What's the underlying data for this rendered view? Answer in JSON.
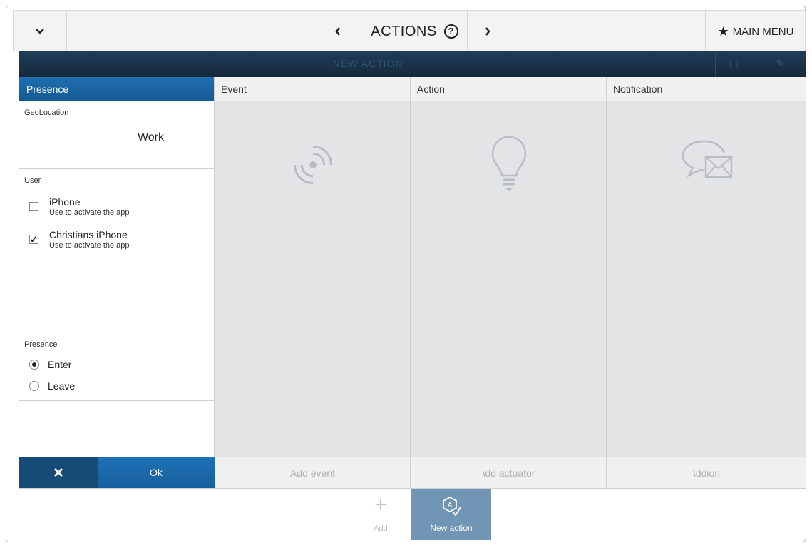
{
  "topbar": {
    "menu_toggle_icon": "chevron-down-icon",
    "prev_icon": "chevron-left-icon",
    "title": "ACTIONS",
    "help_label": "?",
    "next_icon": "chevron-right-icon",
    "main_menu_label": "MAIN MENU",
    "main_menu_icon": "star-icon"
  },
  "darkbar": {
    "title": "NEW ACTION",
    "icons": [
      "trash-icon",
      "wrench-icon"
    ]
  },
  "left_panel": {
    "header": "Presence",
    "geolocation": {
      "label": "GeoLocation",
      "value": "Work"
    },
    "user": {
      "label": "User",
      "items": [
        {
          "name": "iPhone",
          "sub": "Use to activate the app",
          "checked": false
        },
        {
          "name": "Christians iPhone",
          "sub": "Use to activate the app",
          "checked": true
        }
      ]
    },
    "presence": {
      "label": "Presence",
      "options": [
        {
          "label": "Enter",
          "selected": true
        },
        {
          "label": "Leave",
          "selected": false
        }
      ]
    },
    "cancel_icon": "close-icon",
    "ok_label": "Ok"
  },
  "columns": [
    {
      "header": "Event",
      "icon": "signal-icon",
      "footer": "Add event"
    },
    {
      "header": "Action",
      "icon": "lightbulb-icon",
      "footer": "\\dd actuator"
    },
    {
      "header": "Notification",
      "icon": "message-envelope-icon",
      "footer": "\\ddion"
    }
  ],
  "bottom_toolbar": {
    "add_label": "Add",
    "add_icon": "plus-icon",
    "new_action_label": "New action",
    "new_action_icon": "new-action-icon"
  },
  "colors": {
    "header_blue": "#1f6eb0",
    "dark_bar": "#1f3d57",
    "cancel_blue": "#164b78",
    "new_action_bg": "#7195b4",
    "column_bg": "#e2e4e6"
  }
}
